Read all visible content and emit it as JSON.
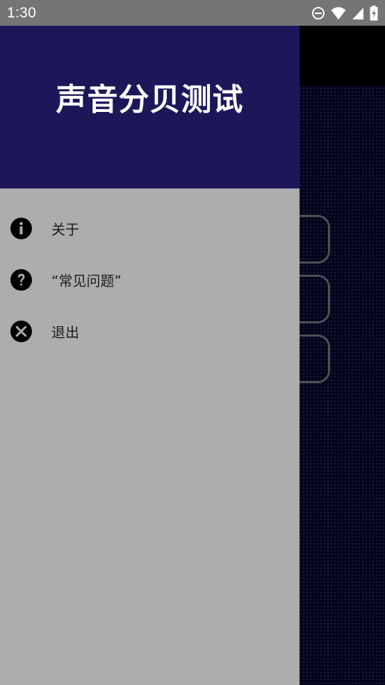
{
  "status_bar": {
    "time": "1:30",
    "icons": [
      "do-not-disturb-icon",
      "wifi-icon",
      "cellular-signal-icon",
      "battery-charging-icon"
    ]
  },
  "drawer": {
    "title": "声音分贝测试",
    "header_color": "#1d175a",
    "background_color": "#adadad",
    "items": [
      {
        "label": "关于",
        "icon": "info-icon"
      },
      {
        "label": "“常见问题”",
        "icon": "help-icon"
      },
      {
        "label": "退出",
        "icon": "close-circle-icon"
      }
    ]
  }
}
